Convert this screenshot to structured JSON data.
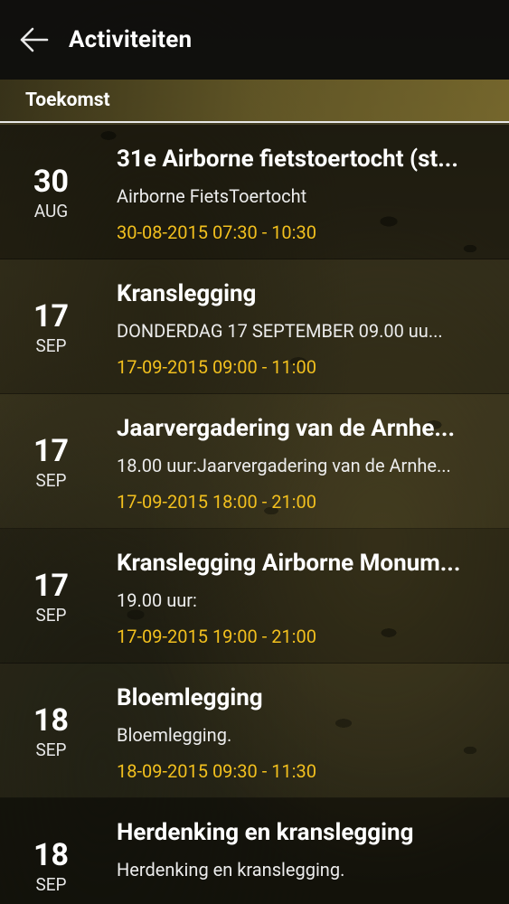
{
  "app_bar": {
    "title": "Activiteiten",
    "back_icon": "arrow-left-icon"
  },
  "section": {
    "title": "Toekomst"
  },
  "colors": {
    "accent": "#f2c01e",
    "app_bar_bg": "#0a0a0a"
  },
  "items": [
    {
      "day": "30",
      "month": "AUG",
      "title": "31e Airborne fietstoertocht (st...",
      "description": "Airborne FietsToertocht",
      "time": "30-08-2015 07:30 - 10:30"
    },
    {
      "day": "17",
      "month": "SEP",
      "title": "Kranslegging",
      "description": "DONDERDAG  17 SEPTEMBER  09.00 uu...",
      "time": "17-09-2015 09:00 - 11:00"
    },
    {
      "day": "17",
      "month": "SEP",
      "title": "Jaarvergadering van de Arnhe...",
      "description": "18.00 uur:Jaarvergadering van de Arnhe...",
      "time": "17-09-2015 18:00 - 21:00"
    },
    {
      "day": "17",
      "month": "SEP",
      "title": "Kranslegging Airborne Monum...",
      "description": "19.00 uur:",
      "time": "17-09-2015 19:00 - 21:00"
    },
    {
      "day": "18",
      "month": "SEP",
      "title": "Bloemlegging",
      "description": "Bloemlegging.",
      "time": "18-09-2015 09:30 - 11:30"
    },
    {
      "day": "18",
      "month": "SEP",
      "title": "Herdenking en kranslegging",
      "description": "Herdenking en kranslegging.",
      "time": ""
    }
  ]
}
